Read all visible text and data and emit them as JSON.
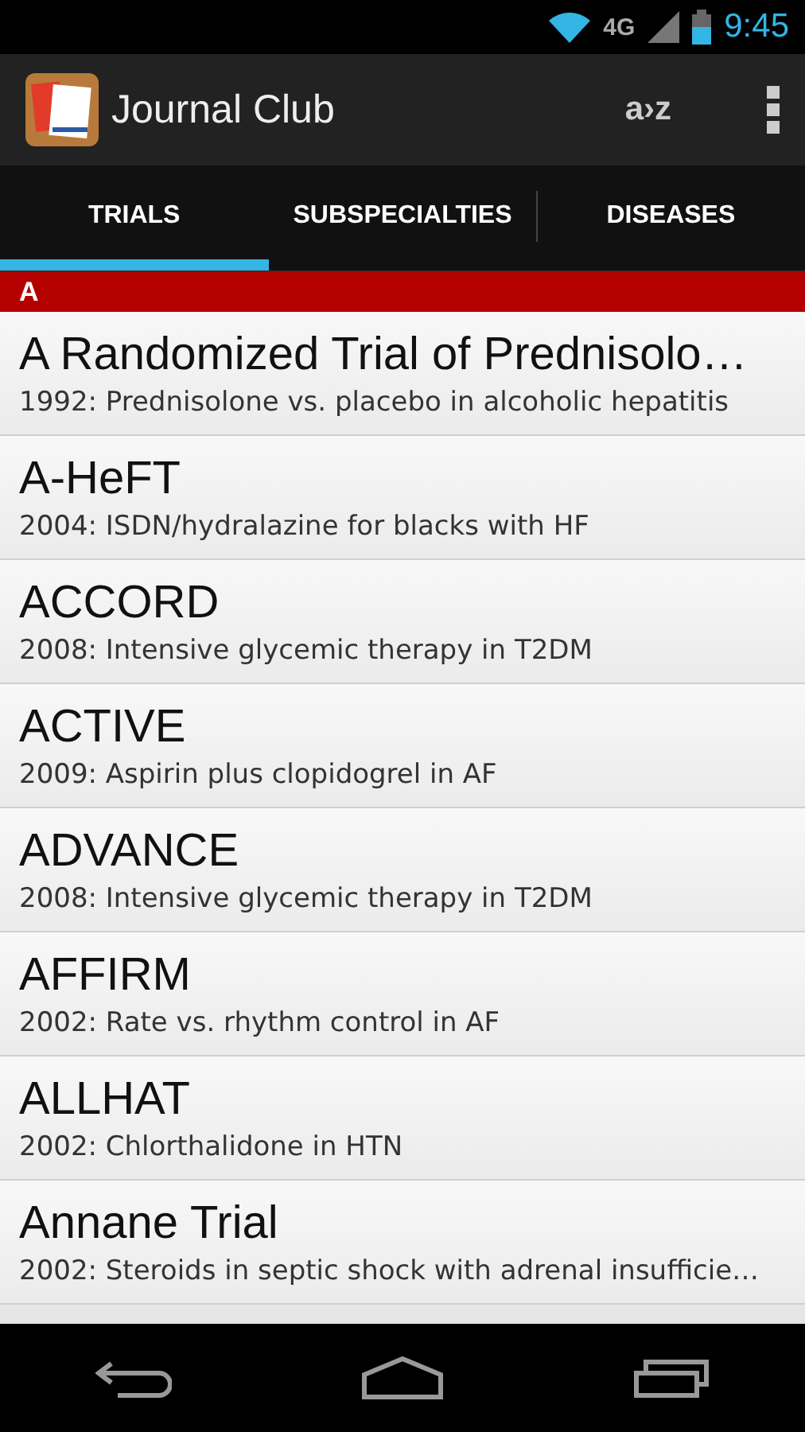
{
  "status_bar": {
    "network": "4G",
    "time": "9:45"
  },
  "action_bar": {
    "title": "Journal Club",
    "sort_label": "a›z"
  },
  "tabs": [
    {
      "label": "TRIALS",
      "selected": true
    },
    {
      "label": "SUBSPECIALTIES",
      "selected": false
    },
    {
      "label": "DISEASES",
      "selected": false
    }
  ],
  "section": {
    "header": "A"
  },
  "trials": [
    {
      "name": "A Randomized Trial of Prednisolo…",
      "summary": "1992: Prednisolone vs. placebo in alcoholic hepatitis"
    },
    {
      "name": "A-HeFT",
      "summary": "2004: ISDN/hydralazine for blacks with HF"
    },
    {
      "name": "ACCORD",
      "summary": "2008: Intensive glycemic therapy in T2DM"
    },
    {
      "name": "ACTIVE",
      "summary": "2009: Aspirin plus clopidogrel in AF"
    },
    {
      "name": "ADVANCE",
      "summary": "2008: Intensive glycemic therapy in T2DM"
    },
    {
      "name": "AFFIRM",
      "summary": "2002: Rate vs. rhythm control in AF"
    },
    {
      "name": "ALLHAT",
      "summary": "2002: Chlorthalidone in HTN"
    },
    {
      "name": "Annane Trial",
      "summary": "2002: Steroids in septic shock with adrenal insufficie…"
    }
  ]
}
